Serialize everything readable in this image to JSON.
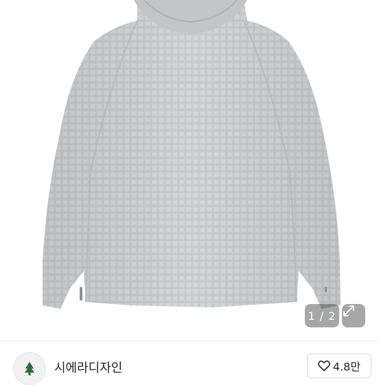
{
  "gallery": {
    "image_alt": "Gray waffle-knit hooded pullover",
    "counter": "1 / 2",
    "expand_icon": "expand-icon"
  },
  "seller": {
    "name": "시에라디자인",
    "avatar_icon": "tree-logo-icon"
  },
  "likes": {
    "icon": "heart-icon",
    "count": "4.8만"
  }
}
